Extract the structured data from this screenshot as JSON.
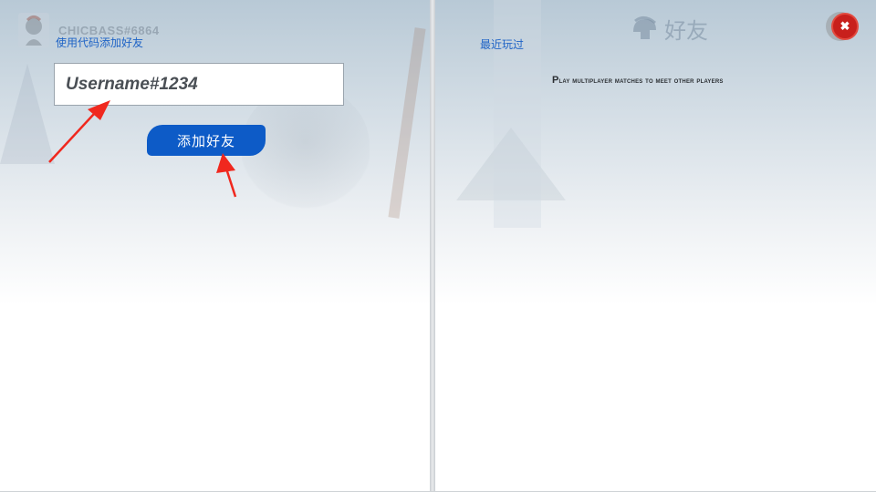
{
  "left_panel": {
    "account_name": "CHICBASS#6864",
    "add_by_code_label": "使用代码添加好友",
    "username_input": {
      "value": "",
      "placeholder": "Username#1234"
    },
    "add_friend_button": "添加好友"
  },
  "right_panel": {
    "recent_tab_label": "最近玩过",
    "title": "好友",
    "empty_message": "Play multiplayer matches to meet other players",
    "close_glyph": "✖"
  },
  "colors": {
    "accent_blue": "#0d5bc7",
    "link_blue": "#1e63c6",
    "close_red": "#c8201c",
    "annotation_red": "#f0281e"
  },
  "icons": {
    "avatar": "spartan-avatar-icon",
    "title": "spartan-helmet-icon",
    "close": "close-icon"
  }
}
